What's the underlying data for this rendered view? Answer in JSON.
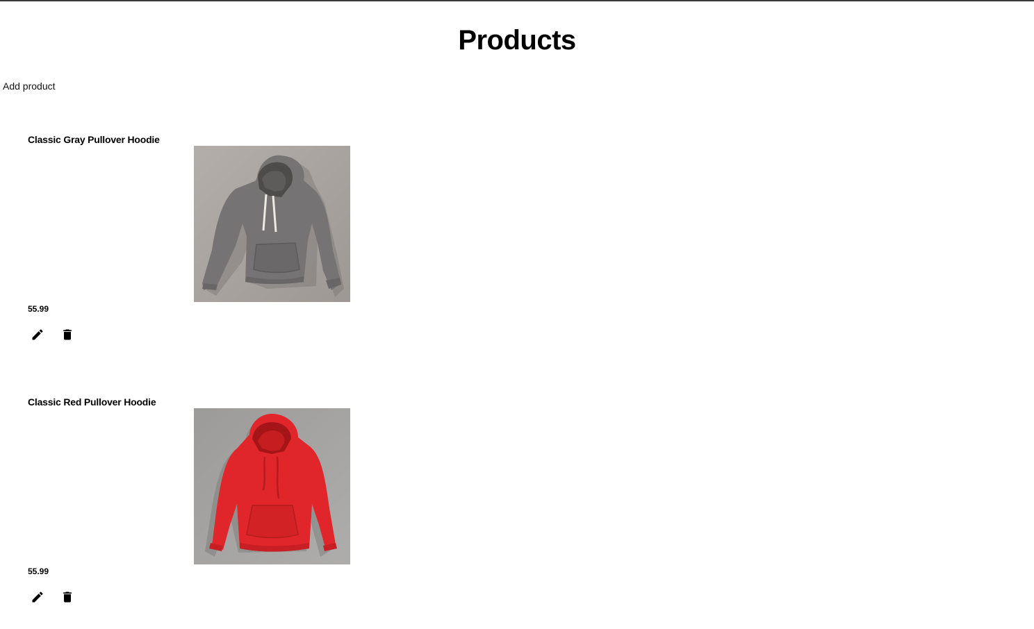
{
  "page": {
    "title": "Products",
    "add_product_label": "Add product"
  },
  "products": [
    {
      "name": "Classic Gray Pullover Hoodie",
      "price": "55.99",
      "image_icon": "gray-hoodie-image",
      "colors": {
        "background": "#aaa5a2",
        "garment": "#757373"
      }
    },
    {
      "name": "Classic Red Pullover Hoodie",
      "price": "55.99",
      "image_icon": "red-hoodie-image",
      "colors": {
        "background": "#a3a2a0",
        "garment": "#e0262a"
      }
    }
  ],
  "actions": {
    "edit_icon": "pencil-icon",
    "delete_icon": "trash-icon"
  }
}
